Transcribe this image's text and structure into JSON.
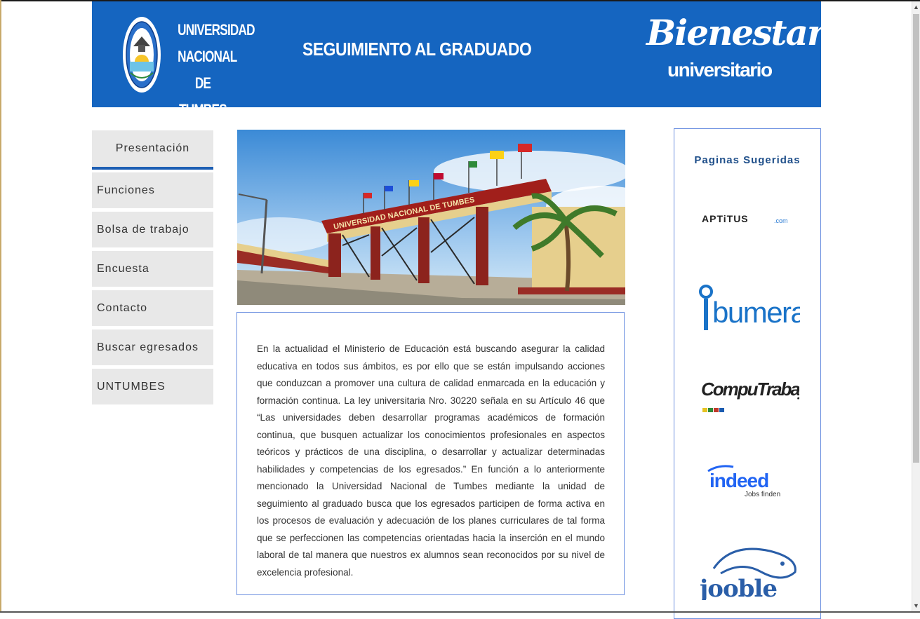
{
  "header": {
    "university_line1": "UNIVERSIDAD",
    "university_line2": "NACIONAL",
    "university_line3": "DE TUMBES",
    "title": "SEGUIMIENTO AL GRADUADO",
    "brand_line1": "Bienestar",
    "brand_line2": "universitario",
    "background_color": "#1565c0"
  },
  "nav": {
    "items": [
      {
        "label": "Presentación",
        "active": true
      },
      {
        "label": "Funciones"
      },
      {
        "label": "Bolsa de trabajo"
      },
      {
        "label": "Encuesta"
      },
      {
        "label": "Contacto"
      },
      {
        "label": "Buscar egresados"
      },
      {
        "label": "UNTUMBES"
      }
    ]
  },
  "photo": {
    "gate_sign": "UNIVERSIDAD NACIONAL DE TUMBES"
  },
  "content": {
    "paragraph": "En la actualidad el Ministerio de Educación está buscando asegurar la calidad educativa en todos sus ámbitos, es por ello que se están impulsando acciones que conduzcan a promover una cultura de calidad enmarcada en la educación y formación continua. La ley universitaria Nro. 30220 señala en su Artículo 46 que “Las universidades deben desarrollar programas académicos de formación continua, que busquen actualizar los conocimientos profesionales en aspectos teóricos y prácticos de una disciplina, o desarrollar y actualizar determinadas habilidades y competencias de los egresados.” En función a lo anteriormente mencionado la Universidad Nacional de Tumbes mediante la unidad de seguimiento al graduado busca que los egresados participen de forma activa en los procesos de evaluación y adecuación de los planes curriculares de tal forma que se perfeccionen las competencias orientadas hacia la inserción en el mundo laboral de tal manera que nuestros ex alumnos sean reconocidos por su nivel de excelencia profesional."
  },
  "sidebar": {
    "title": "Paginas Sugeridas",
    "links": [
      {
        "name": "APTiTUS",
        "suffix": ".com"
      },
      {
        "name": "bumeran"
      },
      {
        "name": "CompuTrabajo"
      },
      {
        "name": "indeed",
        "tagline": "Jobs finden"
      },
      {
        "name": "jooble"
      }
    ]
  }
}
